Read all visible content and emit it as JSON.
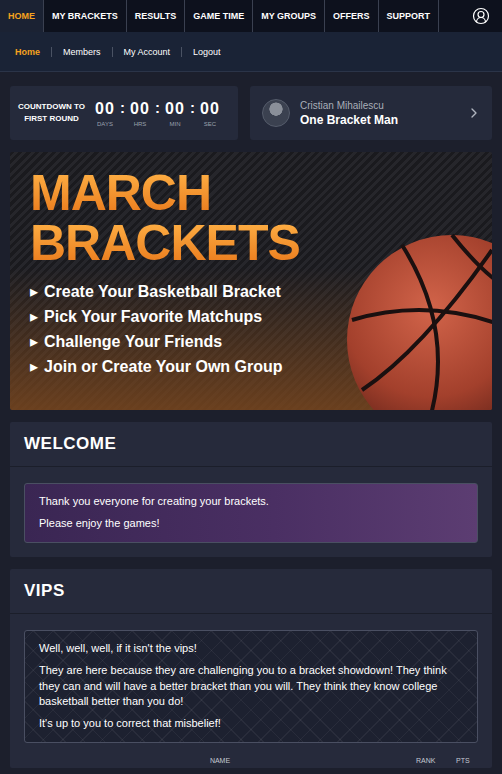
{
  "nav": {
    "items": [
      {
        "label": "HOME",
        "selected": true
      },
      {
        "label": "MY BRACKETS",
        "selected": false
      },
      {
        "label": "RESULTS",
        "selected": false
      },
      {
        "label": "GAME TIME",
        "selected": false
      },
      {
        "label": "MY GROUPS",
        "selected": false
      },
      {
        "label": "OFFERS",
        "selected": false
      },
      {
        "label": "SUPPORT",
        "selected": false
      }
    ]
  },
  "subnav": {
    "items": [
      {
        "label": "Home",
        "selected": true
      },
      {
        "label": "Members",
        "selected": false
      },
      {
        "label": "My Account",
        "selected": false
      },
      {
        "label": "Logout",
        "selected": false
      }
    ]
  },
  "countdown": {
    "title": [
      "COUNTDOWN TO",
      "FIRST ROUND"
    ],
    "separator": ":",
    "units": [
      {
        "value": "00",
        "label": "DAYS"
      },
      {
        "value": "00",
        "label": "HRS"
      },
      {
        "value": "00",
        "label": "MIN"
      },
      {
        "value": "00",
        "label": "SEC"
      }
    ]
  },
  "profile": {
    "name": "Cristian Mihailescu",
    "title": "One Bracket Man"
  },
  "banner": {
    "title": [
      "MARCH",
      "BRACKETS"
    ],
    "bullet": "▸",
    "items": [
      "Create Your Basketball Bracket",
      "Pick Your Favorite Matchups",
      "Challenge Your Friends",
      "Join or Create Your Own Group"
    ]
  },
  "welcome": {
    "title": "WELCOME",
    "lines": [
      "Thank you everyone for creating your brackets.",
      "Please enjoy the games!"
    ]
  },
  "vips": {
    "title": "VIPS",
    "paragraphs": [
      "Well, well, well, if it isn't the vips!",
      "They are here because they are challenging you to a bracket showdown! They think they can and will have a better bracket than you will. They think they know college basketball better than you do!",
      "It's up to you to correct that misbelief!"
    ],
    "columns": [
      "NAME",
      "RANK",
      "PTS"
    ]
  }
}
